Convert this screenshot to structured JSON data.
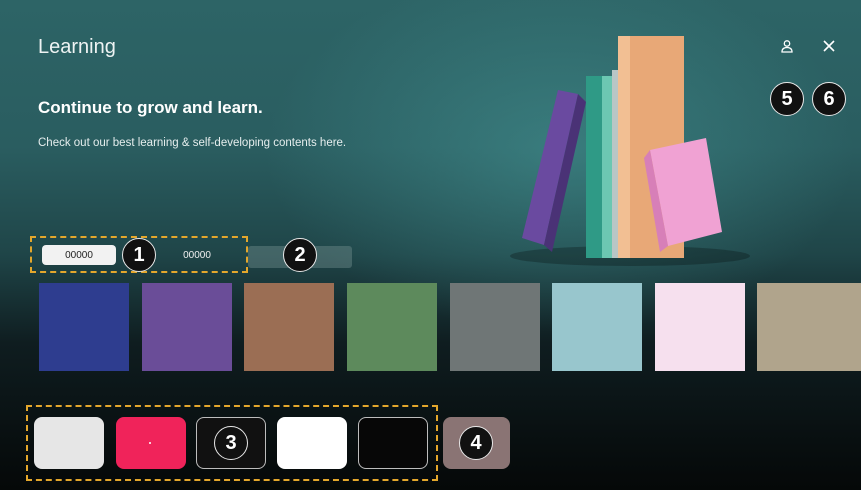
{
  "header": {
    "app_title": "Learning",
    "headline": "Continue to grow and learn.",
    "subline": "Check out our best learning & self-developing contents here."
  },
  "icons": {
    "profile": "profile-icon",
    "close": "close-icon"
  },
  "tabs": [
    {
      "label": "00000",
      "selected": true
    },
    {
      "label": "00000",
      "selected": false
    }
  ],
  "badges": {
    "b1": "1",
    "b2": "2",
    "b3": "3",
    "b4": "4",
    "b5": "5",
    "b6": "6"
  },
  "tiles": [
    {
      "color": "#2e3d8f"
    },
    {
      "color": "#6a4d98"
    },
    {
      "color": "#9b6e54"
    },
    {
      "color": "#5d8a5c"
    },
    {
      "color": "#6f7676"
    },
    {
      "color": "#98c6cd"
    },
    {
      "color": "#f6e0ee"
    },
    {
      "color": "#b0a48c"
    }
  ],
  "apps": [
    {
      "color": "#e6e6e6"
    },
    {
      "color": "#f0235a"
    },
    {
      "color": "#111111"
    },
    {
      "color": "#ffffff"
    },
    {
      "color": "#070707"
    }
  ],
  "more_button_color": "#8a7474",
  "accent_dash_color": "#e4a72c"
}
